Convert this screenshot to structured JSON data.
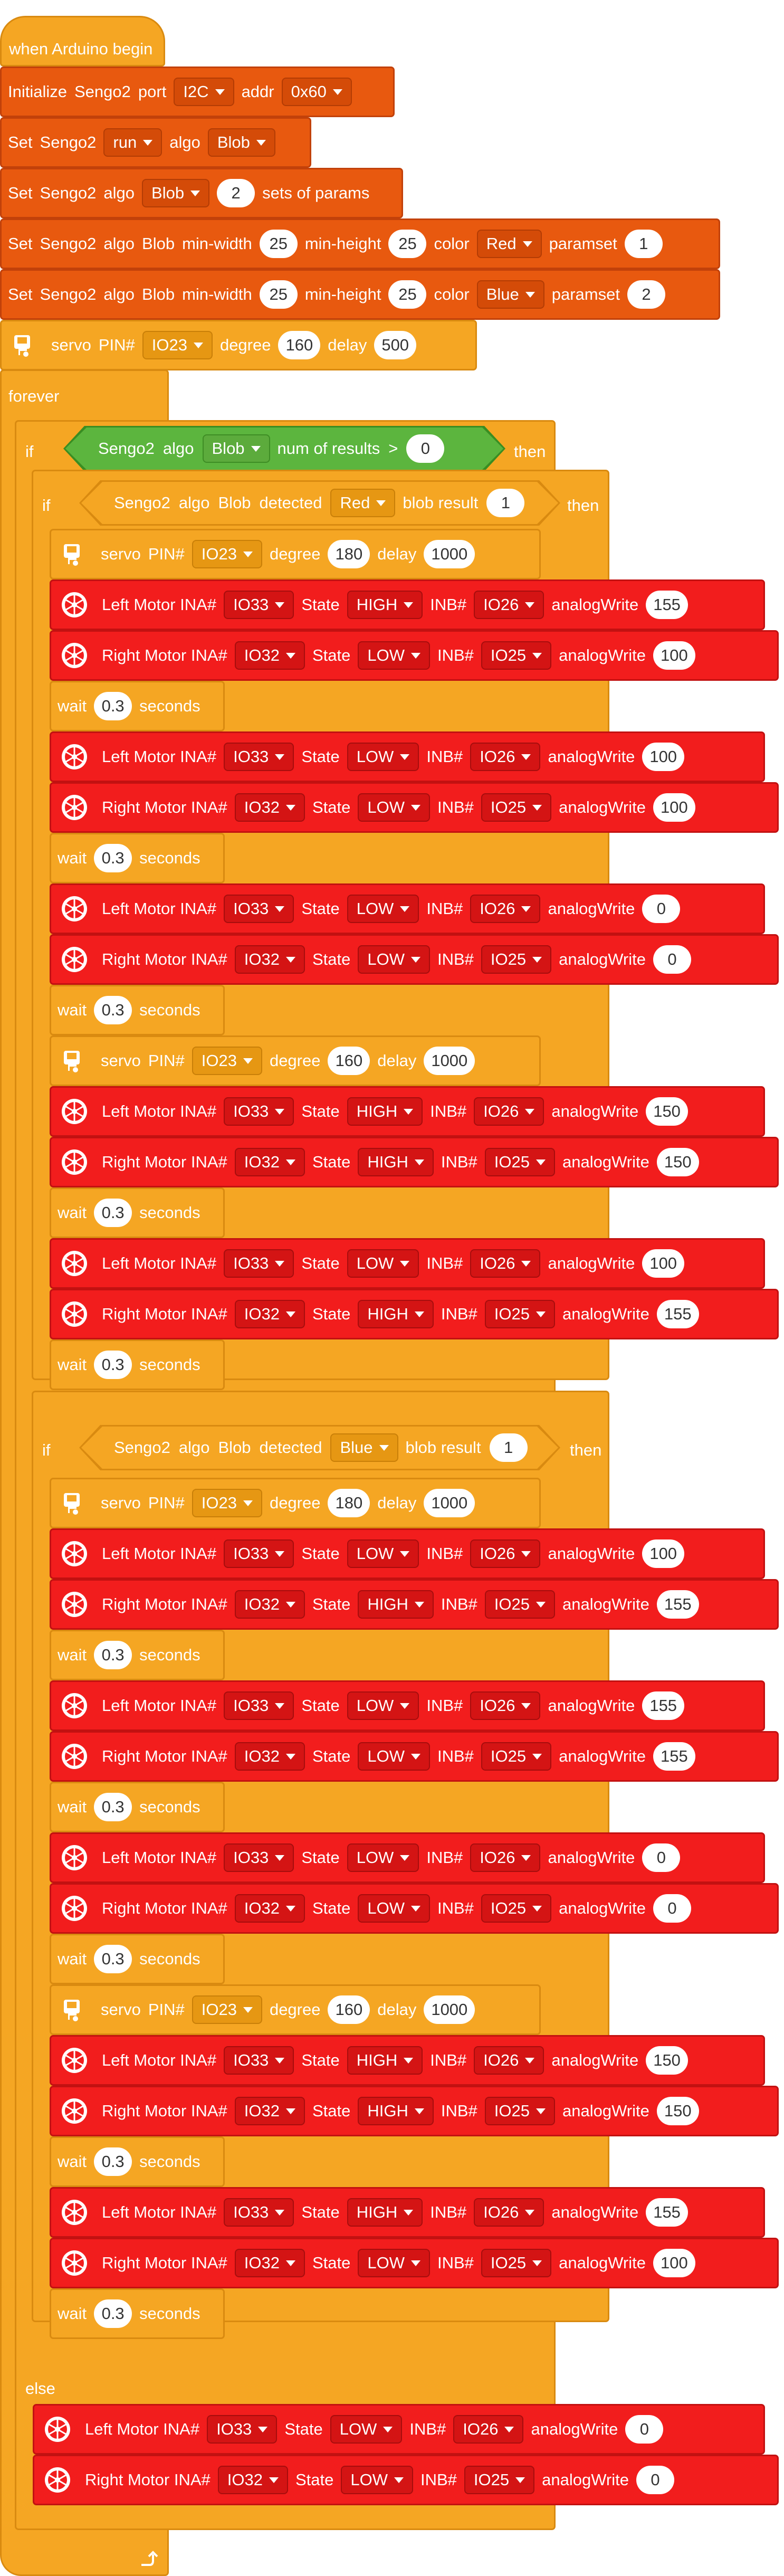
{
  "hat": {
    "label": "when Arduino begin"
  },
  "setup": {
    "init": {
      "t1": "Initialize",
      "t2": "Sengo2",
      "t3": "port",
      "port": "I2C",
      "t4": "addr",
      "addr": "0x60"
    },
    "set_run": {
      "t1": "Set",
      "t2": "Sengo2",
      "mode": "run",
      "t3": "algo",
      "algo": "Blob"
    },
    "set_params": {
      "t1": "Set",
      "t2": "Sengo2",
      "t3": "algo",
      "algo": "Blob",
      "count": "2",
      "t4": "sets of params"
    },
    "params": [
      {
        "t1": "Set",
        "t2": "Sengo2",
        "t3": "algo",
        "t4": "Blob",
        "t5": "min-width",
        "min_width": "25",
        "t6": "min-height",
        "min_height": "25",
        "t7": "color",
        "color": "Red",
        "t8": "paramset",
        "paramset": "1"
      },
      {
        "t1": "Set",
        "t2": "Sengo2",
        "t3": "algo",
        "t4": "Blob",
        "t5": "min-width",
        "min_width": "25",
        "t6": "min-height",
        "min_height": "25",
        "t7": "color",
        "color": "Blue",
        "t8": "paramset",
        "paramset": "2"
      }
    ],
    "servo": {
      "t1": "servo",
      "t2": "PIN#",
      "pin": "IO23",
      "t3": "degree",
      "degree": "160",
      "t4": "delay",
      "delay": "500"
    }
  },
  "loop": {
    "forever_label": "forever",
    "if_label": "if",
    "then_label": "then",
    "else_label": "else",
    "cond_outer": {
      "t1": "Sengo2",
      "t2": "algo",
      "algo": "Blob",
      "t3": "num of results",
      "op": ">",
      "value": "0"
    },
    "cond_red": {
      "t1": "Sengo2",
      "t2": "algo",
      "t3": "Blob",
      "t4": "detected",
      "color": "Red",
      "t5": "blob result",
      "value": "1"
    },
    "cond_blue": {
      "t1": "Sengo2",
      "t2": "algo",
      "t3": "Blob",
      "t4": "detected",
      "color": "Blue",
      "t5": "blob result",
      "value": "1"
    }
  },
  "stmt_text": {
    "servo": "servo",
    "pin": "PIN#",
    "degree": "degree",
    "delay": "delay",
    "left": "Left Motor INA#",
    "right": "Right Motor INA#",
    "state": "State",
    "inb": "INB#",
    "aw": "analogWrite",
    "wait": "wait",
    "seconds": "seconds"
  },
  "red_branch": [
    {
      "kind": "servo",
      "pin": "IO23",
      "degree": "180",
      "delay": "1000"
    },
    {
      "kind": "motor",
      "side": "left",
      "ina": "IO33",
      "state": "HIGH",
      "inb": "IO26",
      "aw": "155"
    },
    {
      "kind": "motor",
      "side": "right",
      "ina": "IO32",
      "state": "LOW",
      "inb": "IO25",
      "aw": "100"
    },
    {
      "kind": "wait",
      "secs": "0.3"
    },
    {
      "kind": "motor",
      "side": "left",
      "ina": "IO33",
      "state": "LOW",
      "inb": "IO26",
      "aw": "100"
    },
    {
      "kind": "motor",
      "side": "right",
      "ina": "IO32",
      "state": "LOW",
      "inb": "IO25",
      "aw": "100"
    },
    {
      "kind": "wait",
      "secs": "0.3"
    },
    {
      "kind": "motor",
      "side": "left",
      "ina": "IO33",
      "state": "LOW",
      "inb": "IO26",
      "aw": "0"
    },
    {
      "kind": "motor",
      "side": "right",
      "ina": "IO32",
      "state": "LOW",
      "inb": "IO25",
      "aw": "0"
    },
    {
      "kind": "wait",
      "secs": "0.3"
    },
    {
      "kind": "servo",
      "pin": "IO23",
      "degree": "160",
      "delay": "1000"
    },
    {
      "kind": "motor",
      "side": "left",
      "ina": "IO33",
      "state": "HIGH",
      "inb": "IO26",
      "aw": "150"
    },
    {
      "kind": "motor",
      "side": "right",
      "ina": "IO32",
      "state": "HIGH",
      "inb": "IO25",
      "aw": "150"
    },
    {
      "kind": "wait",
      "secs": "0.3"
    },
    {
      "kind": "motor",
      "side": "left",
      "ina": "IO33",
      "state": "LOW",
      "inb": "IO26",
      "aw": "100"
    },
    {
      "kind": "motor",
      "side": "right",
      "ina": "IO32",
      "state": "HIGH",
      "inb": "IO25",
      "aw": "155"
    },
    {
      "kind": "wait",
      "secs": "0.3"
    }
  ],
  "blue_branch": [
    {
      "kind": "servo",
      "pin": "IO23",
      "degree": "180",
      "delay": "1000"
    },
    {
      "kind": "motor",
      "side": "left",
      "ina": "IO33",
      "state": "LOW",
      "inb": "IO26",
      "aw": "100"
    },
    {
      "kind": "motor",
      "side": "right",
      "ina": "IO32",
      "state": "HIGH",
      "inb": "IO25",
      "aw": "155"
    },
    {
      "kind": "wait",
      "secs": "0.3"
    },
    {
      "kind": "motor",
      "side": "left",
      "ina": "IO33",
      "state": "LOW",
      "inb": "IO26",
      "aw": "155"
    },
    {
      "kind": "motor",
      "side": "right",
      "ina": "IO32",
      "state": "LOW",
      "inb": "IO25",
      "aw": "155"
    },
    {
      "kind": "wait",
      "secs": "0.3"
    },
    {
      "kind": "motor",
      "side": "left",
      "ina": "IO33",
      "state": "LOW",
      "inb": "IO26",
      "aw": "0"
    },
    {
      "kind": "motor",
      "side": "right",
      "ina": "IO32",
      "state": "LOW",
      "inb": "IO25",
      "aw": "0"
    },
    {
      "kind": "wait",
      "secs": "0.3"
    },
    {
      "kind": "servo",
      "pin": "IO23",
      "degree": "160",
      "delay": "1000"
    },
    {
      "kind": "motor",
      "side": "left",
      "ina": "IO33",
      "state": "HIGH",
      "inb": "IO26",
      "aw": "150"
    },
    {
      "kind": "motor",
      "side": "right",
      "ina": "IO32",
      "state": "HIGH",
      "inb": "IO25",
      "aw": "150"
    },
    {
      "kind": "wait",
      "secs": "0.3"
    },
    {
      "kind": "motor",
      "side": "left",
      "ina": "IO33",
      "state": "HIGH",
      "inb": "IO26",
      "aw": "155"
    },
    {
      "kind": "motor",
      "side": "right",
      "ina": "IO32",
      "state": "LOW",
      "inb": "IO25",
      "aw": "100"
    },
    {
      "kind": "wait",
      "secs": "0.3"
    }
  ],
  "else_branch": [
    {
      "kind": "motor",
      "side": "left",
      "ina": "IO33",
      "state": "LOW",
      "inb": "IO26",
      "aw": "0"
    },
    {
      "kind": "motor",
      "side": "right",
      "ina": "IO32",
      "state": "LOW",
      "inb": "IO25",
      "aw": "0"
    }
  ],
  "icons": {
    "servo": "servo-motor-icon",
    "motor": "motor-wheel-icon",
    "loop_arrow": "loop-arrow-icon"
  },
  "colors": {
    "orange": "#e8590f",
    "yellow": "#f5a623",
    "red": "#f21d1d",
    "green": "#5cb53e"
  }
}
